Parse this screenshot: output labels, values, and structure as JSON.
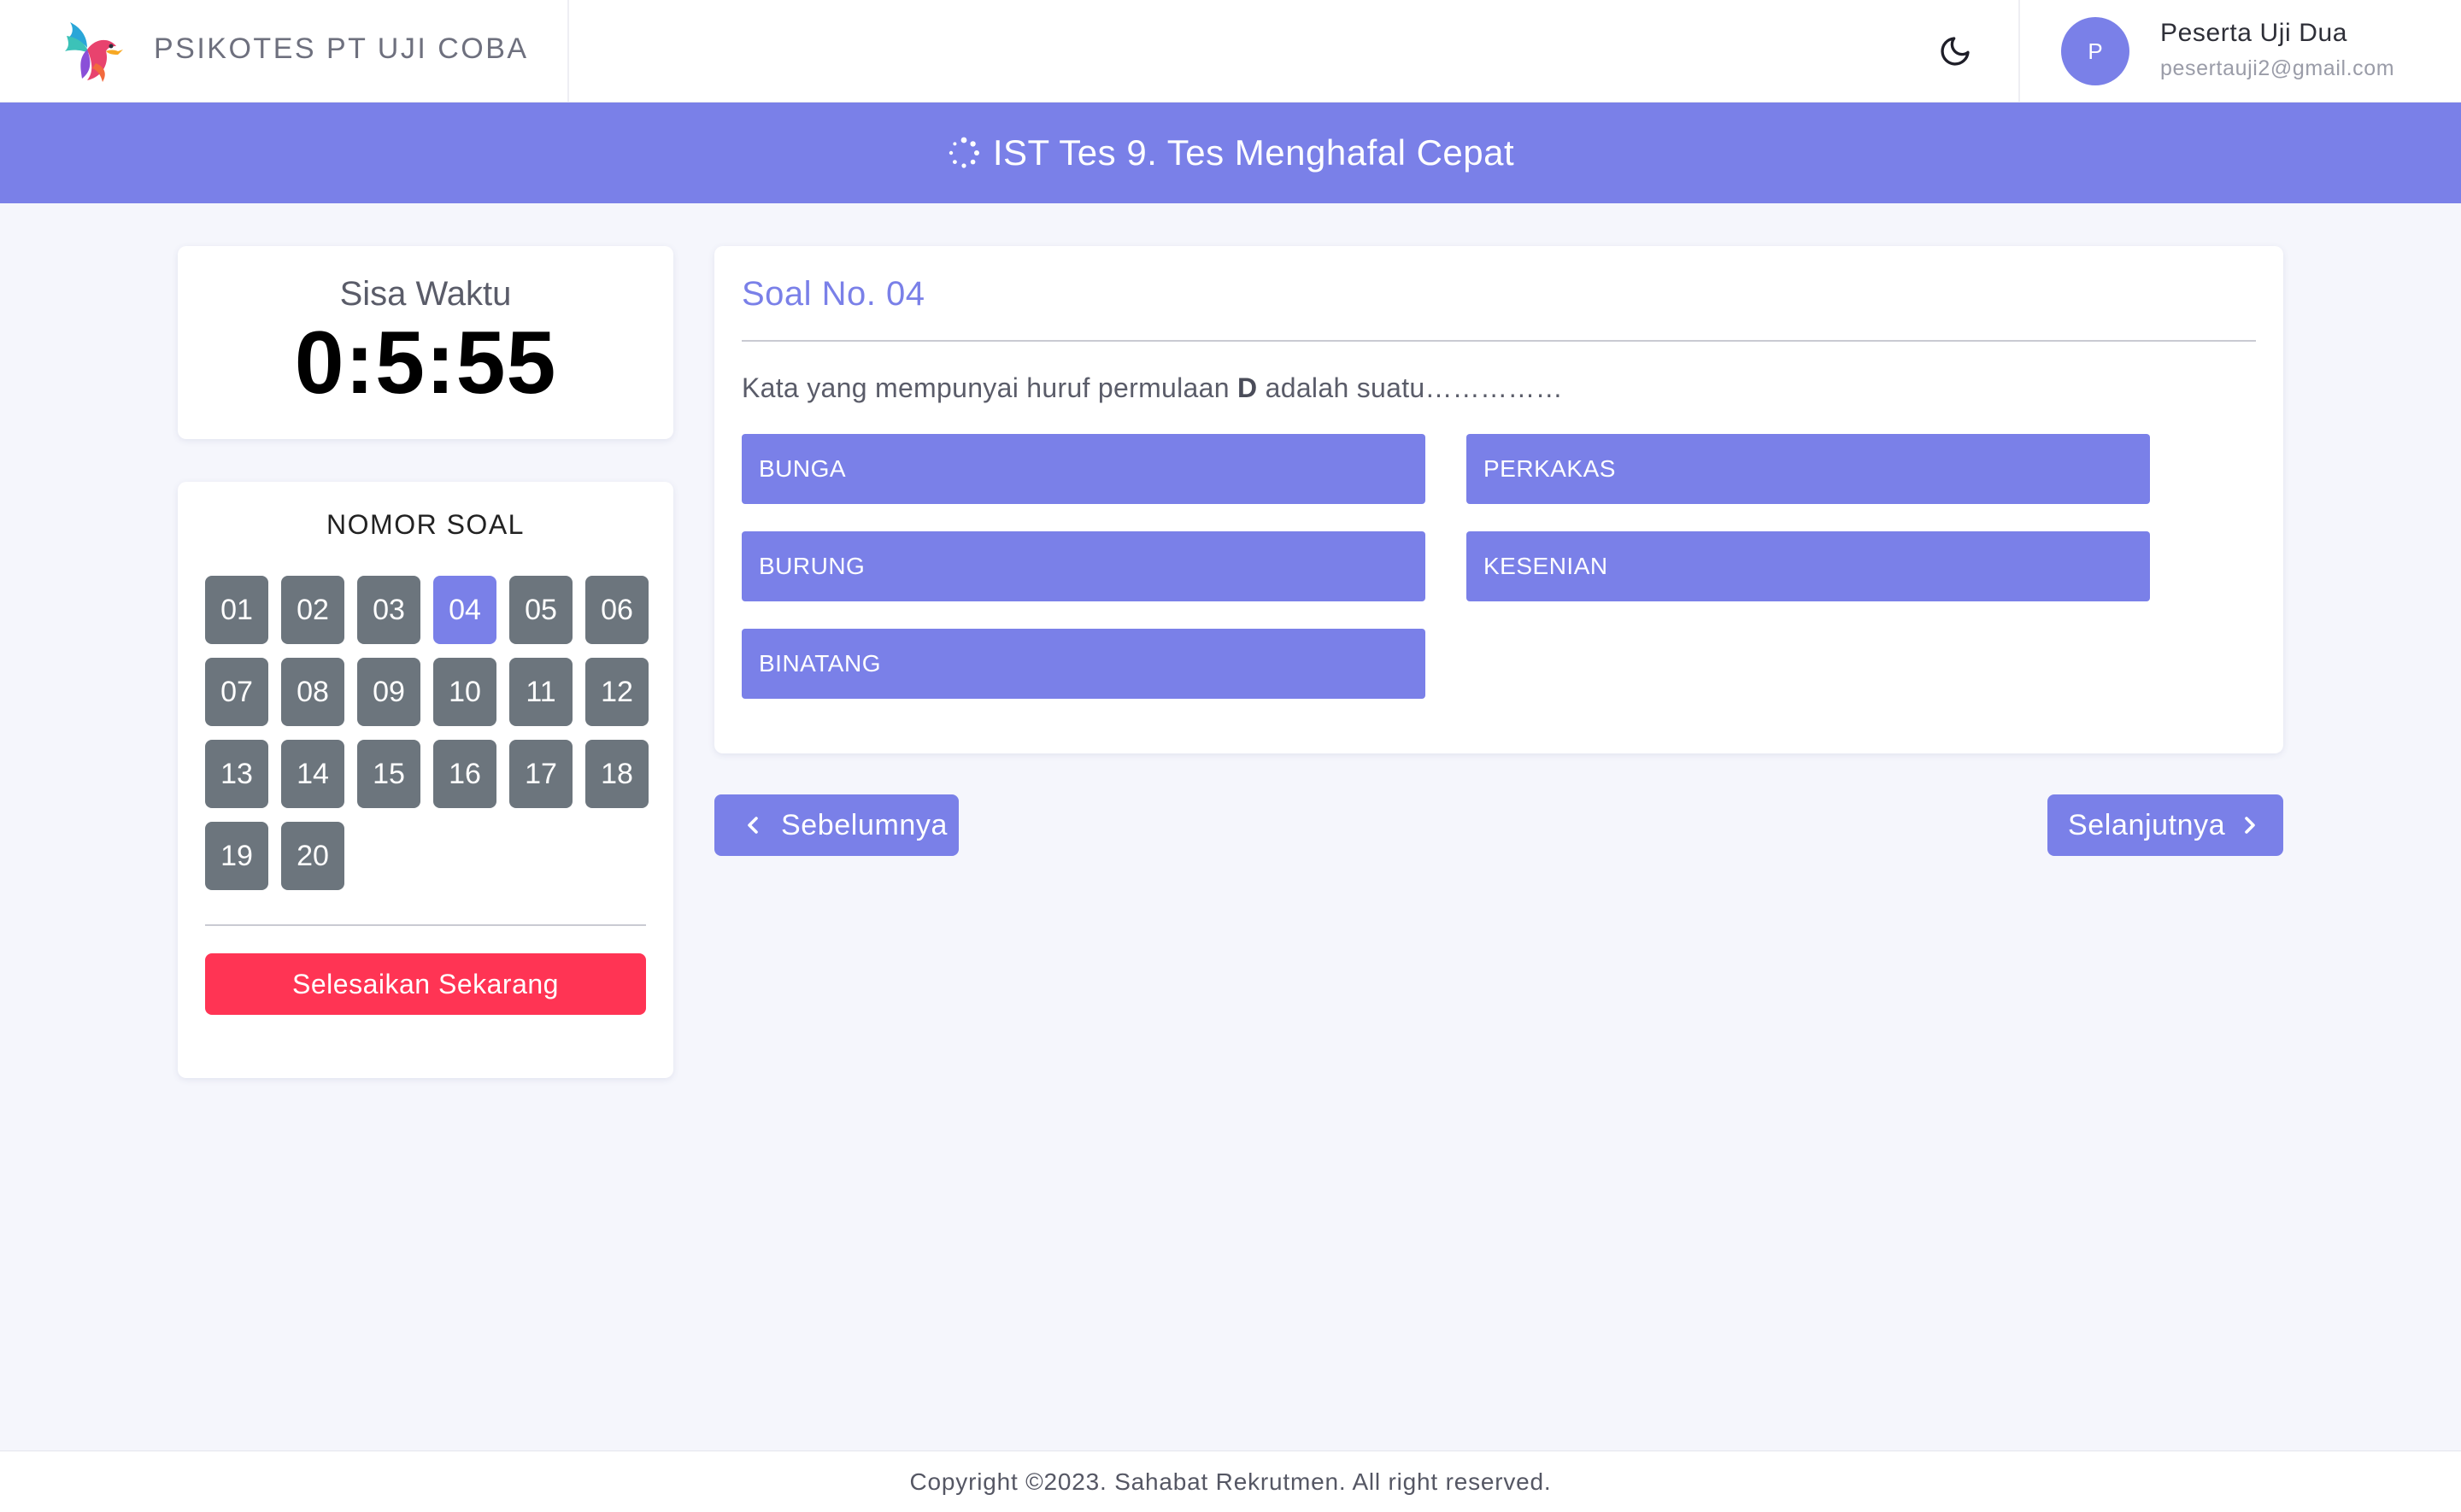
{
  "header": {
    "brand_title": "PSIKOTES PT UJI COBA",
    "logo_icon": "colorful-bird-logo",
    "theme_toggle_icon": "moon-icon",
    "user": {
      "avatar_initial": "P",
      "name": "Peserta Uji Dua",
      "email": "pesertauji2@gmail.com"
    }
  },
  "banner": {
    "icon": "spinner-icon",
    "title": "IST Tes 9. Tes Menghafal Cepat"
  },
  "timer": {
    "label": "Sisa Waktu",
    "value": "0:5:55"
  },
  "question_nav": {
    "title": "NOMOR SOAL",
    "numbers": [
      "01",
      "02",
      "03",
      "04",
      "05",
      "06",
      "07",
      "08",
      "09",
      "10",
      "11",
      "12",
      "13",
      "14",
      "15",
      "16",
      "17",
      "18",
      "19",
      "20"
    ],
    "active": "04",
    "finish_label": "Selesaikan Sekarang"
  },
  "question": {
    "title": "Soal No. 04",
    "text_before": "Kata yang mempunyai huruf permulaan ",
    "text_bold": "D",
    "text_after": " adalah suatu……………",
    "options": [
      "BUNGA",
      "PERKAKAS",
      "BURUNG",
      "KESENIAN",
      "BINATANG"
    ]
  },
  "pagination": {
    "prev_label": "Sebelumnya",
    "next_label": "Selanjutnya"
  },
  "footer": {
    "text": "Copyright ©2023. Sahabat Rekrutmen. All right reserved."
  },
  "colors": {
    "primary": "#7a80e8",
    "question_number_default": "#6c757d",
    "danger": "#ff3454",
    "background": "#f5f6fc"
  }
}
